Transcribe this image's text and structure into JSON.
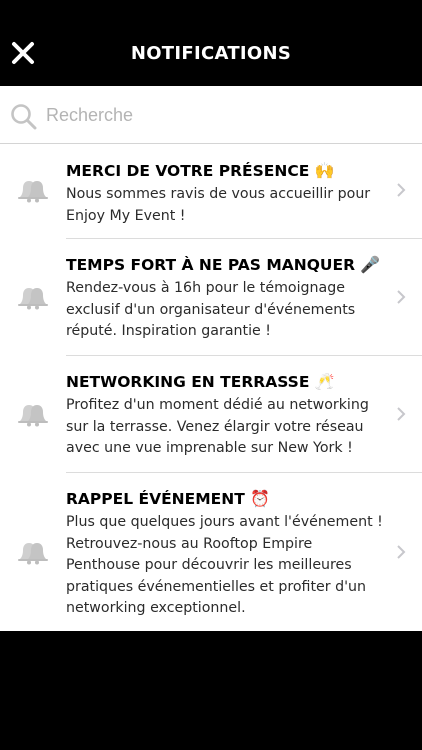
{
  "header": {
    "title": "NOTIFICATIONS",
    "close_icon": "close-icon"
  },
  "search": {
    "placeholder": "Recherche",
    "value": "",
    "icon": "search-icon"
  },
  "notifications": [
    {
      "title": "MERCI DE VOTRE PRÉSENCE",
      "emoji": "🙌",
      "body": "Nous sommes ravis de vous accueillir pour Enjoy My Event !",
      "icon": "bell-icon"
    },
    {
      "title": "TEMPS FORT À NE PAS MANQUER",
      "emoji": "🎤",
      "body": "Rendez-vous à 16h pour le témoignage exclusif d'un organisateur d'événements réputé. Inspiration garantie !",
      "icon": "bell-icon"
    },
    {
      "title": "NETWORKING EN TERRASSE",
      "emoji": "🥂",
      "body": "Profitez d'un moment dédié au networking sur la terrasse. Venez élargir votre réseau avec une vue imprenable sur New York !",
      "icon": "bell-icon"
    },
    {
      "title": "RAPPEL ÉVÉNEMENT",
      "emoji": "⏰",
      "body": "Plus que quelques jours avant l'événement ! Retrouvez-nous au Rooftop Empire Penthouse pour découvrir les meilleures pratiques événementielles et profiter d'un networking exceptionnel.",
      "icon": "bell-icon"
    }
  ]
}
